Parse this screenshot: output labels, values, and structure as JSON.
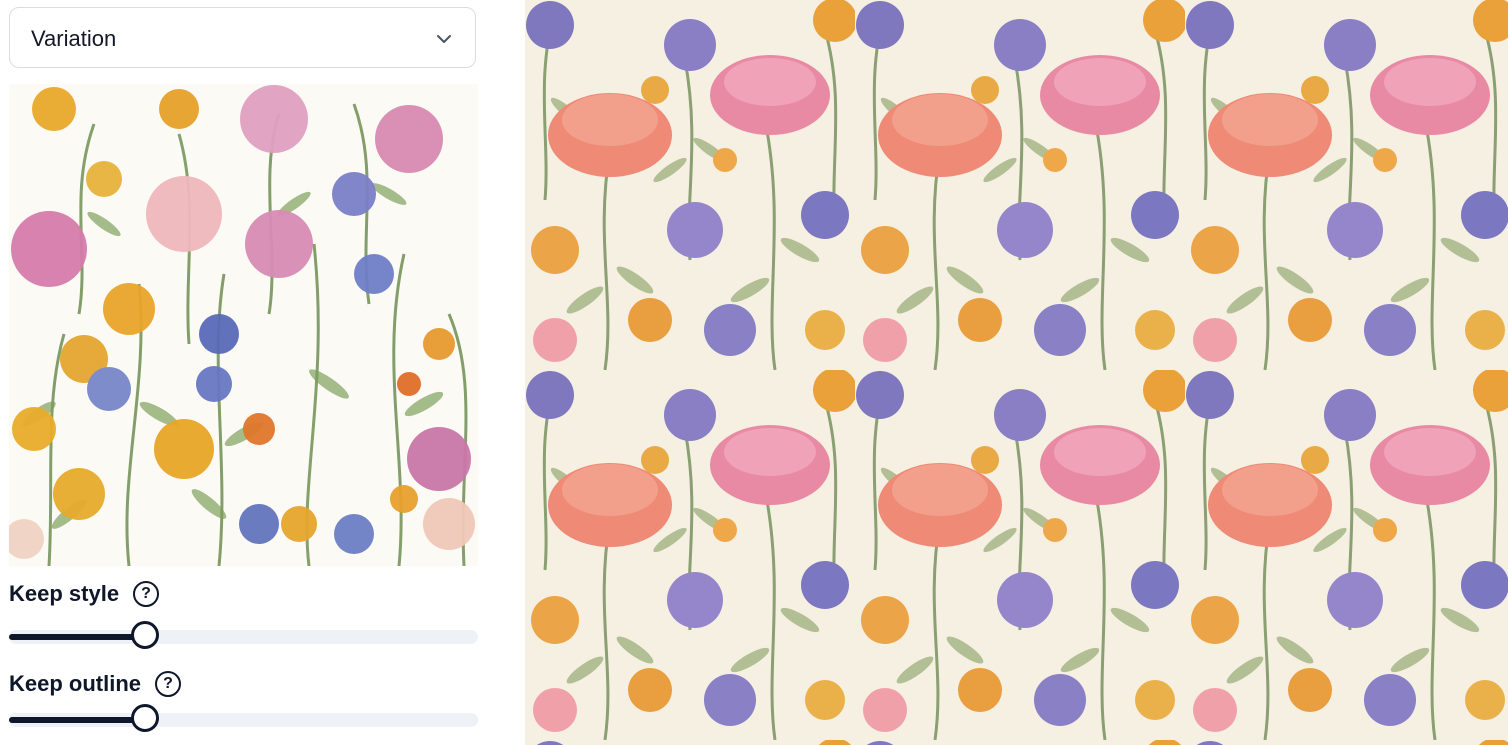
{
  "variation_select": {
    "value": "Variation"
  },
  "controls": {
    "keep_style": {
      "label": "Keep style",
      "help": "?",
      "value": 0.29
    },
    "keep_outline": {
      "label": "Keep outline",
      "help": "?",
      "value": 0.29
    }
  },
  "colors": {
    "accent": "#0f172a",
    "track": "#eef2f6",
    "thumb_bg": "#fbfaf5",
    "canvas_bg": "#f5f0e2"
  },
  "icons": {
    "dropdown": "chevron-down-icon",
    "help": "help-circle-icon"
  }
}
